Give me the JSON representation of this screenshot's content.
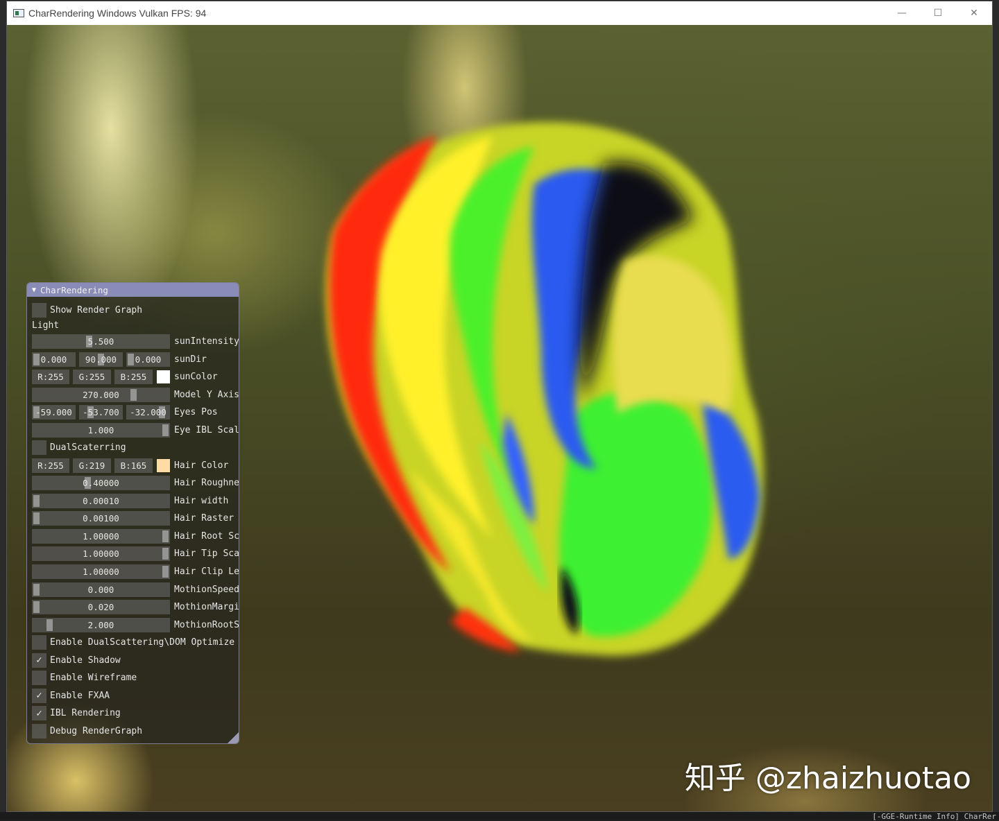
{
  "window": {
    "title": "CharRendering Windows Vulkan FPS: 94",
    "controls": {
      "minimize": "—",
      "maximize": "☐",
      "close": "✕"
    }
  },
  "console_snippet": "[-GGE-Runtime Info] CharRer",
  "watermark": "知乎 @zhaizhuotao",
  "panel": {
    "title": "CharRendering",
    "show_render_graph": {
      "label": "Show Render Graph",
      "checked": false
    },
    "light_header": "Light",
    "sun_intensity": {
      "value": "5.500",
      "label": "sunIntensity",
      "fraction": 0.41
    },
    "sun_dir": {
      "values": [
        "0.000",
        "90.000",
        "0.000"
      ],
      "label": "sunDir",
      "fractions": [
        0.0,
        0.5,
        0.0
      ]
    },
    "sun_color": {
      "values": [
        "R:255",
        "G:255",
        "B:255"
      ],
      "label": "sunColor",
      "swatch": "#ffffff"
    },
    "model_y_axis": {
      "value": "270.000",
      "label": "Model Y Axis",
      "fraction": 0.75
    },
    "eyes_pos": {
      "values": [
        "-59.000",
        "-53.700",
        "-32.000"
      ],
      "label": "Eyes Pos",
      "fractions": [
        0.0,
        0.2,
        0.9
      ]
    },
    "eye_ibl_scale": {
      "value": "1.000",
      "label": "Eye IBL Scale",
      "fraction": 1.0
    },
    "dual_scattering": {
      "label": "DualScaterring",
      "checked": false
    },
    "hair_color": {
      "values": [
        "R:255",
        "G:219",
        "B:165"
      ],
      "label": "Hair Color",
      "swatch": "#ffdba5"
    },
    "sliders": [
      {
        "value": "0.40000",
        "label": "Hair Roughness",
        "fraction": 0.4
      },
      {
        "value": "0.00010",
        "label": "Hair width",
        "fraction": 0.0
      },
      {
        "value": "0.00100",
        "label": "Hair Raster",
        "fraction": 0.0
      },
      {
        "value": "1.00000",
        "label": "Hair Root Scale",
        "fraction": 1.0
      },
      {
        "value": "1.00000",
        "label": "Hair Tip Scale",
        "fraction": 1.0
      },
      {
        "value": "1.00000",
        "label": "Hair Clip Length",
        "fraction": 1.0
      },
      {
        "value": "0.000",
        "label": "MothionSpeed",
        "fraction": 0.0
      },
      {
        "value": "0.020",
        "label": "MothionMargin",
        "fraction": 0.0
      },
      {
        "value": "2.000",
        "label": "MothionRootScale",
        "fraction": 0.1
      }
    ],
    "checkboxes": [
      {
        "label": "Enable DualScattering\\DOM Optimize",
        "checked": false
      },
      {
        "label": "Enable Shadow",
        "checked": true
      },
      {
        "label": "Enable Wireframe",
        "checked": false
      },
      {
        "label": "Enable FXAA",
        "checked": true
      },
      {
        "label": "IBL Rendering",
        "checked": true
      },
      {
        "label": "Debug RenderGraph",
        "checked": false
      }
    ]
  }
}
